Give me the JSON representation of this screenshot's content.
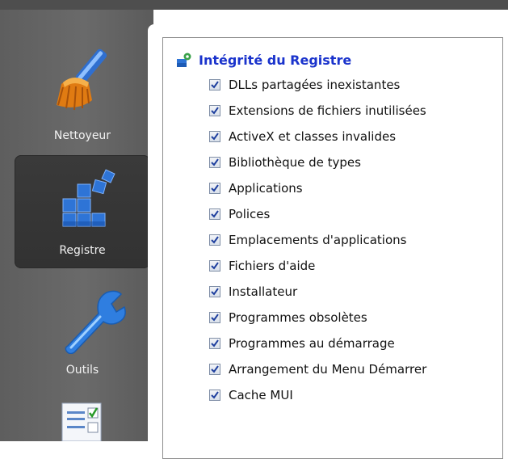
{
  "sidebar": {
    "items": [
      {
        "label": "Nettoyeur",
        "icon": "broom-icon",
        "active": false
      },
      {
        "label": "Registre",
        "icon": "registry-cubes-icon",
        "active": true
      },
      {
        "label": "Outils",
        "icon": "wrench-icon",
        "active": false
      },
      {
        "label": "",
        "icon": "checklist-icon",
        "active": false
      }
    ]
  },
  "section": {
    "title": "Intégrité du Registre",
    "icon": "registry-gear-icon",
    "options": [
      {
        "label": "DLLs partagées inexistantes",
        "checked": true
      },
      {
        "label": "Extensions de fichiers inutilisées",
        "checked": true
      },
      {
        "label": "ActiveX et classes invalides",
        "checked": true
      },
      {
        "label": "Bibliothèque de types",
        "checked": true
      },
      {
        "label": "Applications",
        "checked": true
      },
      {
        "label": "Polices",
        "checked": true
      },
      {
        "label": "Emplacements d'applications",
        "checked": true
      },
      {
        "label": "Fichiers d'aide",
        "checked": true
      },
      {
        "label": "Installateur",
        "checked": true
      },
      {
        "label": "Programmes obsolètes",
        "checked": true
      },
      {
        "label": "Programmes au démarrage",
        "checked": true
      },
      {
        "label": "Arrangement du Menu Démarrer",
        "checked": true
      },
      {
        "label": "Cache MUI",
        "checked": true
      }
    ]
  },
  "colors": {
    "sidebar_bg": "#666666",
    "active_bg": "#363636",
    "title_blue": "#1a33cc",
    "check_blue": "#1e3f9e"
  }
}
